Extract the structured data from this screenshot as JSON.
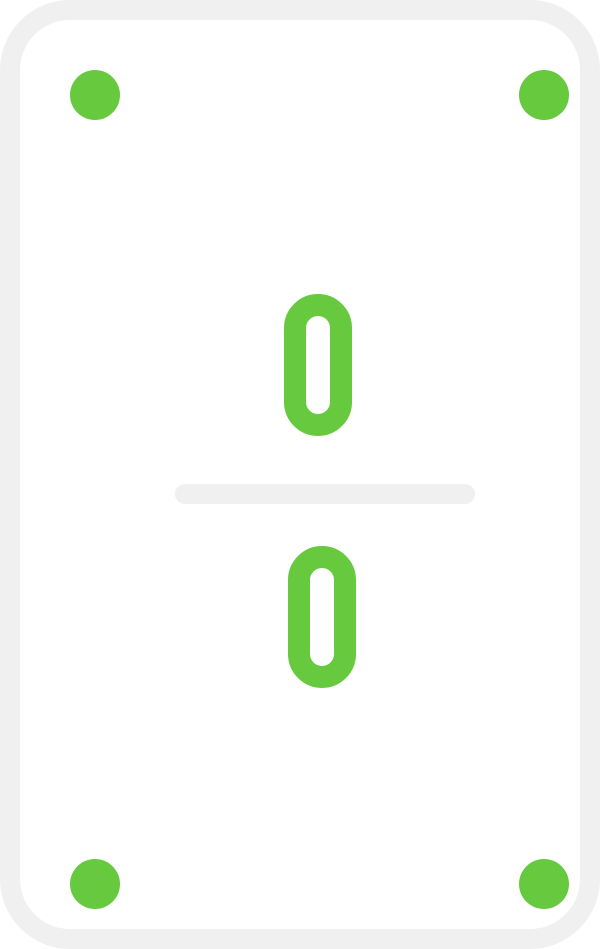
{
  "card": {
    "top_value": "0",
    "bottom_value": "0",
    "pip_color": "#66c93e",
    "border_color": "#f0f0f0",
    "background_color": "#ffffff"
  }
}
